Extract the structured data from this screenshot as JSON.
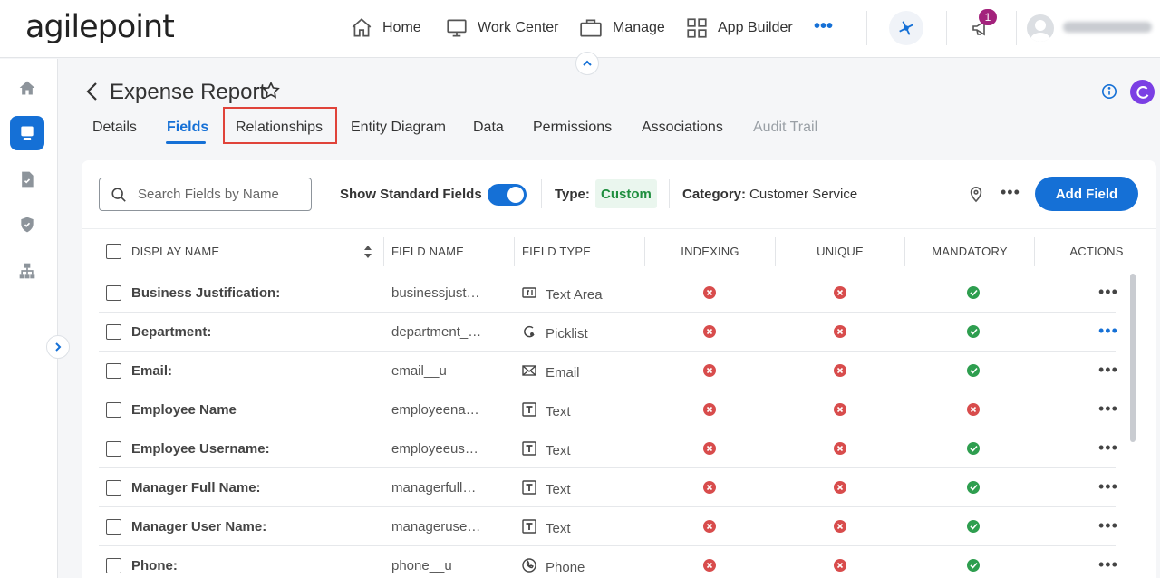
{
  "topbar": {
    "logo": "agilepoint",
    "nav": [
      {
        "label": "Home",
        "icon": "home-icon"
      },
      {
        "label": "Work Center",
        "icon": "monitor-icon"
      },
      {
        "label": "Manage",
        "icon": "briefcase-icon"
      },
      {
        "label": "App Builder",
        "icon": "grid-icon"
      }
    ],
    "more": "•••",
    "notification_count": "1"
  },
  "header": {
    "title": "Expense Report",
    "tabs": [
      {
        "label": "Details"
      },
      {
        "label": "Fields",
        "active": true
      },
      {
        "label": "Relationships",
        "highlighted": true
      },
      {
        "label": "Entity Diagram"
      },
      {
        "label": "Data"
      },
      {
        "label": "Permissions"
      },
      {
        "label": "Associations"
      },
      {
        "label": "Audit Trail",
        "disabled": true
      }
    ],
    "avatar_letter": "C"
  },
  "toolbar": {
    "search_placeholder": "Search Fields by Name",
    "show_standard_label": "Show Standard Fields",
    "show_standard_on": true,
    "type_label": "Type:",
    "type_value": "Custom",
    "category_label": "Category:",
    "category_value": "Customer Service",
    "add_label": "Add Field"
  },
  "table": {
    "headers": {
      "display_name": "DISPLAY NAME",
      "field_name": "FIELD NAME",
      "field_type": "FIELD TYPE",
      "indexing": "INDEXING",
      "unique": "UNIQUE",
      "mandatory": "MANDATORY",
      "actions": "ACTIONS"
    },
    "rows": [
      {
        "display": "Business Justification:",
        "field": "businessjustification__u",
        "type": "Text Area",
        "type_icon": "text-area-icon",
        "indexing": false,
        "unique": false,
        "mandatory": true
      },
      {
        "display": "Department:",
        "field": "department__u",
        "type": "Picklist",
        "type_icon": "picklist-icon",
        "indexing": false,
        "unique": false,
        "mandatory": true
      },
      {
        "display": "Email:",
        "field": "email__u",
        "type": "Email",
        "type_icon": "email-icon",
        "indexing": false,
        "unique": false,
        "mandatory": true
      },
      {
        "display": "Employee Name",
        "field": "employeename__u",
        "type": "Text",
        "type_icon": "text-icon",
        "indexing": false,
        "unique": false,
        "mandatory": false
      },
      {
        "display": "Employee Username:",
        "field": "employeeusername__u",
        "type": "Text",
        "type_icon": "text-icon",
        "indexing": false,
        "unique": false,
        "mandatory": true
      },
      {
        "display": "Manager Full Name:",
        "field": "managerfullname__u",
        "type": "Text",
        "type_icon": "text-icon",
        "indexing": false,
        "unique": false,
        "mandatory": true
      },
      {
        "display": "Manager User Name:",
        "field": "managerusername__u",
        "type": "Text",
        "type_icon": "text-icon",
        "indexing": false,
        "unique": false,
        "mandatory": true
      },
      {
        "display": "Phone:",
        "field": "phone__u",
        "type": "Phone",
        "type_icon": "phone-icon",
        "indexing": false,
        "unique": false,
        "mandatory": true
      }
    ],
    "actions_label": "•••"
  },
  "colors": {
    "accent": "#1570d6",
    "error": "#d84c4c",
    "success": "#2e9e4f",
    "highlight": "#e0433a"
  }
}
